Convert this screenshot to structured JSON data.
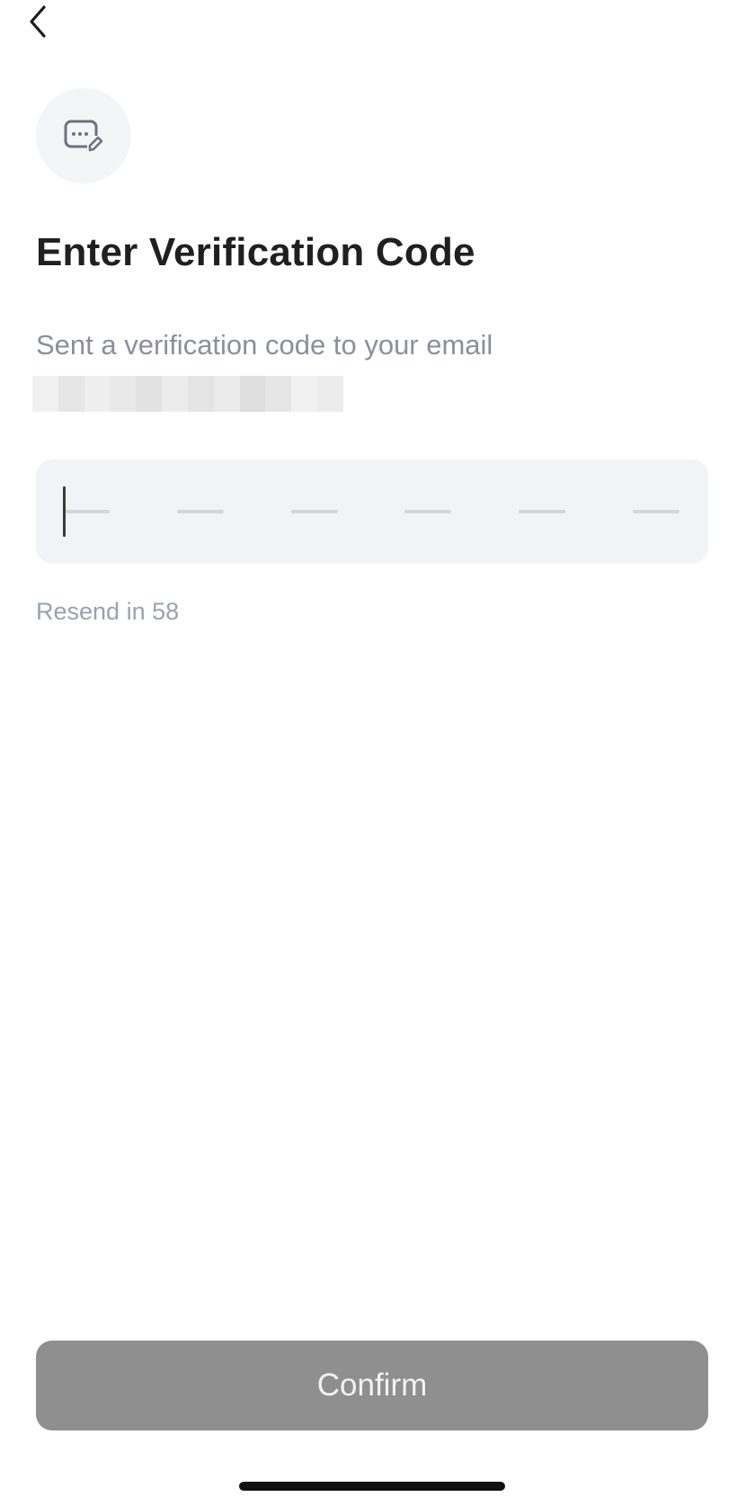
{
  "header": {
    "back_icon": "chevron-left-icon"
  },
  "hero_icon": "message-edit-icon",
  "title": "Enter Verification Code",
  "subtitle": "Sent a verification code to your email",
  "otp": {
    "length": 6,
    "value": ""
  },
  "resend_text": "Resend in 58",
  "confirm_label": "Confirm",
  "colors": {
    "confirm_bg": "#8f8f8f",
    "input_bg": "#f2f3f7",
    "muted_text": "#8a8f9c"
  }
}
